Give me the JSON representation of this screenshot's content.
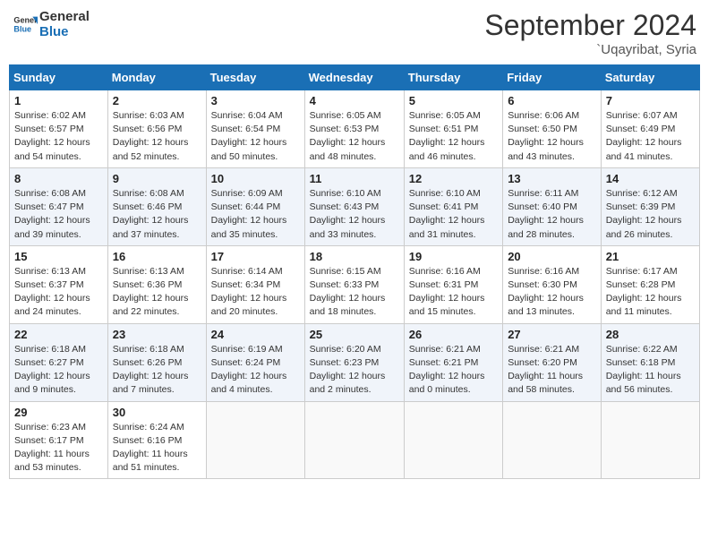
{
  "logo": {
    "line1": "General",
    "line2": "Blue"
  },
  "title": "September 2024",
  "subtitle": "`Uqayribat, Syria",
  "days_of_week": [
    "Sunday",
    "Monday",
    "Tuesday",
    "Wednesday",
    "Thursday",
    "Friday",
    "Saturday"
  ],
  "weeks": [
    [
      {
        "day": "1",
        "info": "Sunrise: 6:02 AM\nSunset: 6:57 PM\nDaylight: 12 hours\nand 54 minutes."
      },
      {
        "day": "2",
        "info": "Sunrise: 6:03 AM\nSunset: 6:56 PM\nDaylight: 12 hours\nand 52 minutes."
      },
      {
        "day": "3",
        "info": "Sunrise: 6:04 AM\nSunset: 6:54 PM\nDaylight: 12 hours\nand 50 minutes."
      },
      {
        "day": "4",
        "info": "Sunrise: 6:05 AM\nSunset: 6:53 PM\nDaylight: 12 hours\nand 48 minutes."
      },
      {
        "day": "5",
        "info": "Sunrise: 6:05 AM\nSunset: 6:51 PM\nDaylight: 12 hours\nand 46 minutes."
      },
      {
        "day": "6",
        "info": "Sunrise: 6:06 AM\nSunset: 6:50 PM\nDaylight: 12 hours\nand 43 minutes."
      },
      {
        "day": "7",
        "info": "Sunrise: 6:07 AM\nSunset: 6:49 PM\nDaylight: 12 hours\nand 41 minutes."
      }
    ],
    [
      {
        "day": "8",
        "info": "Sunrise: 6:08 AM\nSunset: 6:47 PM\nDaylight: 12 hours\nand 39 minutes."
      },
      {
        "day": "9",
        "info": "Sunrise: 6:08 AM\nSunset: 6:46 PM\nDaylight: 12 hours\nand 37 minutes."
      },
      {
        "day": "10",
        "info": "Sunrise: 6:09 AM\nSunset: 6:44 PM\nDaylight: 12 hours\nand 35 minutes."
      },
      {
        "day": "11",
        "info": "Sunrise: 6:10 AM\nSunset: 6:43 PM\nDaylight: 12 hours\nand 33 minutes."
      },
      {
        "day": "12",
        "info": "Sunrise: 6:10 AM\nSunset: 6:41 PM\nDaylight: 12 hours\nand 31 minutes."
      },
      {
        "day": "13",
        "info": "Sunrise: 6:11 AM\nSunset: 6:40 PM\nDaylight: 12 hours\nand 28 minutes."
      },
      {
        "day": "14",
        "info": "Sunrise: 6:12 AM\nSunset: 6:39 PM\nDaylight: 12 hours\nand 26 minutes."
      }
    ],
    [
      {
        "day": "15",
        "info": "Sunrise: 6:13 AM\nSunset: 6:37 PM\nDaylight: 12 hours\nand 24 minutes."
      },
      {
        "day": "16",
        "info": "Sunrise: 6:13 AM\nSunset: 6:36 PM\nDaylight: 12 hours\nand 22 minutes."
      },
      {
        "day": "17",
        "info": "Sunrise: 6:14 AM\nSunset: 6:34 PM\nDaylight: 12 hours\nand 20 minutes."
      },
      {
        "day": "18",
        "info": "Sunrise: 6:15 AM\nSunset: 6:33 PM\nDaylight: 12 hours\nand 18 minutes."
      },
      {
        "day": "19",
        "info": "Sunrise: 6:16 AM\nSunset: 6:31 PM\nDaylight: 12 hours\nand 15 minutes."
      },
      {
        "day": "20",
        "info": "Sunrise: 6:16 AM\nSunset: 6:30 PM\nDaylight: 12 hours\nand 13 minutes."
      },
      {
        "day": "21",
        "info": "Sunrise: 6:17 AM\nSunset: 6:28 PM\nDaylight: 12 hours\nand 11 minutes."
      }
    ],
    [
      {
        "day": "22",
        "info": "Sunrise: 6:18 AM\nSunset: 6:27 PM\nDaylight: 12 hours\nand 9 minutes."
      },
      {
        "day": "23",
        "info": "Sunrise: 6:18 AM\nSunset: 6:26 PM\nDaylight: 12 hours\nand 7 minutes."
      },
      {
        "day": "24",
        "info": "Sunrise: 6:19 AM\nSunset: 6:24 PM\nDaylight: 12 hours\nand 4 minutes."
      },
      {
        "day": "25",
        "info": "Sunrise: 6:20 AM\nSunset: 6:23 PM\nDaylight: 12 hours\nand 2 minutes."
      },
      {
        "day": "26",
        "info": "Sunrise: 6:21 AM\nSunset: 6:21 PM\nDaylight: 12 hours\nand 0 minutes."
      },
      {
        "day": "27",
        "info": "Sunrise: 6:21 AM\nSunset: 6:20 PM\nDaylight: 11 hours\nand 58 minutes."
      },
      {
        "day": "28",
        "info": "Sunrise: 6:22 AM\nSunset: 6:18 PM\nDaylight: 11 hours\nand 56 minutes."
      }
    ],
    [
      {
        "day": "29",
        "info": "Sunrise: 6:23 AM\nSunset: 6:17 PM\nDaylight: 11 hours\nand 53 minutes."
      },
      {
        "day": "30",
        "info": "Sunrise: 6:24 AM\nSunset: 6:16 PM\nDaylight: 11 hours\nand 51 minutes."
      },
      {
        "day": "",
        "info": ""
      },
      {
        "day": "",
        "info": ""
      },
      {
        "day": "",
        "info": ""
      },
      {
        "day": "",
        "info": ""
      },
      {
        "day": "",
        "info": ""
      }
    ]
  ]
}
